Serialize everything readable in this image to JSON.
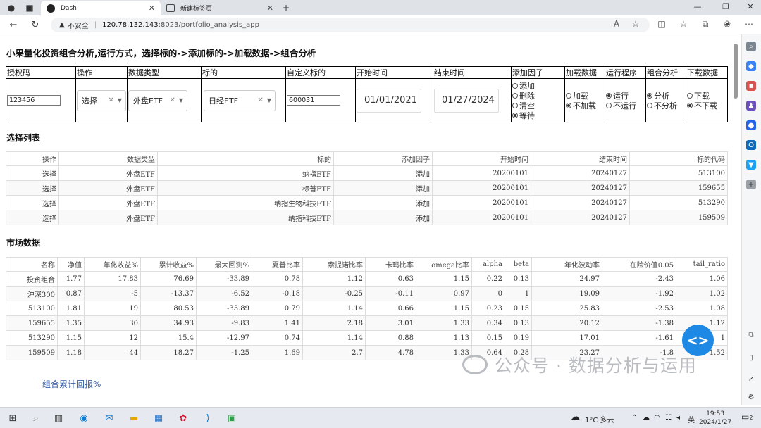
{
  "browser": {
    "tabs": [
      {
        "title": "Dash",
        "active": true
      },
      {
        "title": "新建标签页",
        "active": false
      }
    ],
    "security": "不安全",
    "url_host": "120.78.132.143",
    "url_path": ":8023/portfolio_analysis_app"
  },
  "page": {
    "title": "小果量化投资组合分析,运行方式，选择标的->添加标的->加载数据->组合分析",
    "controls": {
      "headers": [
        "授权码",
        "操作",
        "数据类型",
        "标的",
        "自定义标的",
        "开始时间",
        "结束时间",
        "添加因子",
        "加载数据",
        "运行程序",
        "组合分析",
        "下载数据"
      ],
      "auth_code": "123456",
      "operation": "选择",
      "data_type": "外盘ETF",
      "target": "日经ETF",
      "custom_target": "600031",
      "start_date": "01/01/2021",
      "end_date": "01/27/2024",
      "factor_options": [
        {
          "label": "添加",
          "checked": false
        },
        {
          "label": "删除",
          "checked": false
        },
        {
          "label": "清空",
          "checked": false
        },
        {
          "label": "等待",
          "checked": true
        }
      ],
      "load_options": [
        {
          "label": "加载",
          "checked": false
        },
        {
          "label": "不加载",
          "checked": true
        }
      ],
      "run_options": [
        {
          "label": "运行",
          "checked": true
        },
        {
          "label": "不运行",
          "checked": false
        }
      ],
      "analyze_options": [
        {
          "label": "分析",
          "checked": true
        },
        {
          "label": "不分析",
          "checked": false
        }
      ],
      "download_options": [
        {
          "label": "下载",
          "checked": false
        },
        {
          "label": "不下载",
          "checked": true
        }
      ]
    },
    "selection": {
      "title": "选择列表",
      "columns": [
        "操作",
        "数据类型",
        "标的",
        "添加因子",
        "开始时间",
        "结束时间",
        "标的代码"
      ],
      "rows": [
        [
          "选择",
          "外盘ETF",
          "纳指ETF",
          "添加",
          "20200101",
          "20240127",
          "513100"
        ],
        [
          "选择",
          "外盘ETF",
          "标普ETF",
          "添加",
          "20200101",
          "20240127",
          "159655"
        ],
        [
          "选择",
          "外盘ETF",
          "纳指生物科技ETF",
          "添加",
          "20200101",
          "20240127",
          "513290"
        ],
        [
          "选择",
          "外盘ETF",
          "纳指科技ETF",
          "添加",
          "20200101",
          "20240127",
          "159509"
        ]
      ]
    },
    "market": {
      "title": "市场数据",
      "columns": [
        "名称",
        "净值",
        "年化收益%",
        "累计收益%",
        "最大回测%",
        "夏普比率",
        "索提诺比率",
        "卡玛比率",
        "omega比率",
        "alpha",
        "beta",
        "年化波动率",
        "在险价值0.05",
        "tail_ratio"
      ],
      "rows": [
        [
          "投资组合",
          "1.77",
          "17.83",
          "76.69",
          "-33.89",
          "0.78",
          "1.12",
          "0.63",
          "1.15",
          "0.22",
          "0.13",
          "24.97",
          "-2.43",
          "1.06"
        ],
        [
          "沪深300",
          "0.87",
          "-5",
          "-13.37",
          "-6.52",
          "-0.18",
          "-0.25",
          "-0.11",
          "0.97",
          "0",
          "1",
          "19.09",
          "-1.92",
          "1.02"
        ],
        [
          "513100",
          "1.81",
          "19",
          "80.53",
          "-33.89",
          "0.79",
          "1.14",
          "0.66",
          "1.15",
          "0.23",
          "0.15",
          "25.83",
          "-2.53",
          "1.08"
        ],
        [
          "159655",
          "1.35",
          "30",
          "34.93",
          "-9.83",
          "1.41",
          "2.18",
          "3.01",
          "1.33",
          "0.34",
          "0.13",
          "20.12",
          "-1.38",
          "1.12"
        ],
        [
          "513290",
          "1.15",
          "12",
          "15.4",
          "-12.97",
          "0.74",
          "1.14",
          "0.88",
          "1.13",
          "0.15",
          "0.19",
          "17.01",
          "-1.61",
          "1"
        ],
        [
          "159509",
          "1.18",
          "44",
          "18.27",
          "-1.25",
          "1.69",
          "2.7",
          "4.78",
          "1.33",
          "0.64",
          "0.28",
          "23.27",
          "-1.8",
          "1.52"
        ]
      ]
    },
    "return_chart_title": "组合累计回报%",
    "watermark": "公众号 · 数据分析与运用"
  },
  "taskbar": {
    "weather": "1°C 多云",
    "lang": "英",
    "time": "19:53",
    "date": "2024/1/27",
    "notif_count": "2"
  }
}
